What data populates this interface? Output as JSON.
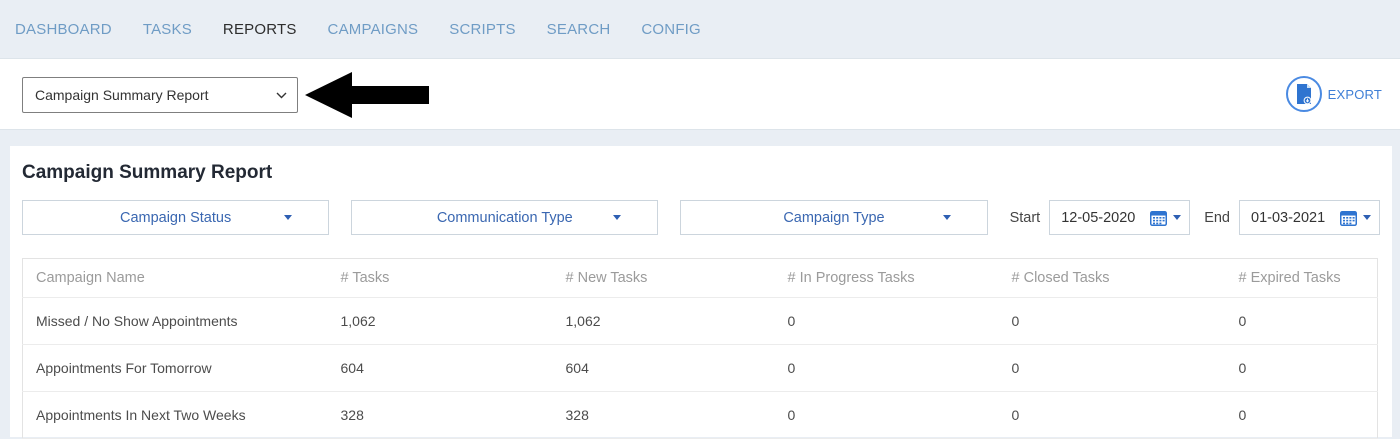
{
  "nav": {
    "items": [
      {
        "label": "DASHBOARD",
        "active": false
      },
      {
        "label": "TASKS",
        "active": false
      },
      {
        "label": "REPORTS",
        "active": true
      },
      {
        "label": "CAMPAIGNS",
        "active": false
      },
      {
        "label": "SCRIPTS",
        "active": false
      },
      {
        "label": "SEARCH",
        "active": false
      },
      {
        "label": "CONFIG",
        "active": false
      }
    ]
  },
  "toolbar": {
    "report_select_value": "Campaign Summary Report",
    "export_label": "EXPORT"
  },
  "main": {
    "title": "Campaign Summary Report",
    "filters": [
      {
        "label": "Campaign Status"
      },
      {
        "label": "Communication Type"
      },
      {
        "label": "Campaign Type"
      }
    ],
    "date_range": {
      "start_label": "Start",
      "start_value": "12-05-2020",
      "end_label": "End",
      "end_value": "01-03-2021"
    },
    "table": {
      "columns": [
        "Campaign Name",
        "# Tasks",
        "# New Tasks",
        "# In Progress Tasks",
        "# Closed Tasks",
        "# Expired Tasks"
      ],
      "rows": [
        {
          "cells": [
            "Missed / No Show Appointments",
            "1,062",
            "1,062",
            "0",
            "0",
            "0"
          ]
        },
        {
          "cells": [
            "Appointments For Tomorrow",
            "604",
            "604",
            "0",
            "0",
            "0"
          ]
        },
        {
          "cells": [
            "Appointments In Next Two Weeks",
            "328",
            "328",
            "0",
            "0",
            "0"
          ]
        }
      ]
    }
  },
  "icons": {
    "select_chevron": "chevron-down-icon",
    "annotation": "arrow-left-icon",
    "export": "document-export-icon",
    "filter_chevron": "triangle-down-icon",
    "date_calendar": "calendar-icon"
  },
  "colors": {
    "page_background": "#e9eef4",
    "nav_link": "#6f9cc5",
    "nav_active": "#2d2d2d",
    "accent_blue": "#3f7fd6",
    "filter_blue": "#3a67b1",
    "heading": "#232934",
    "table_header_gray": "#9b9b9b",
    "annotation_black": "#000000"
  }
}
